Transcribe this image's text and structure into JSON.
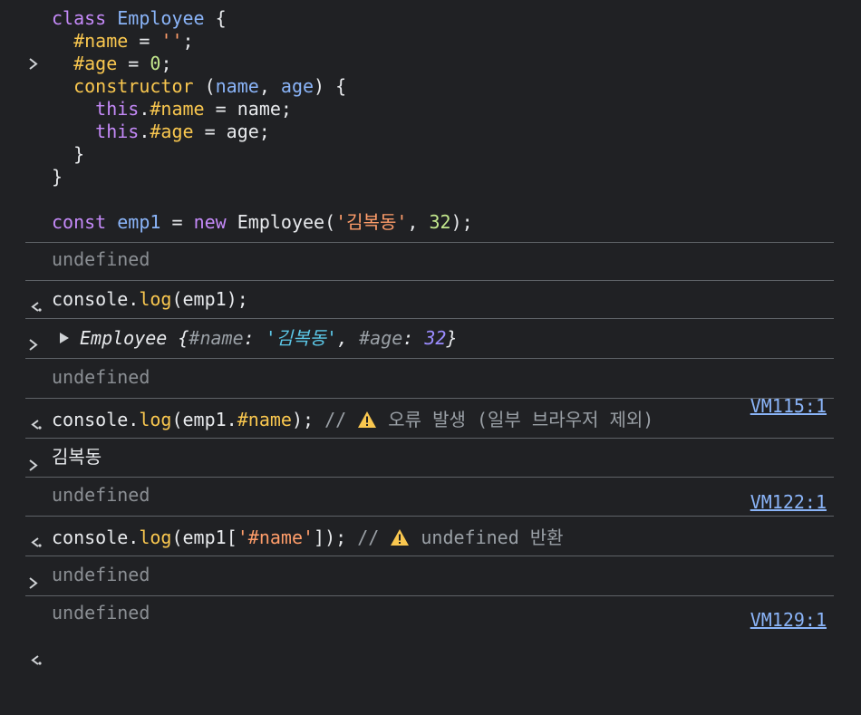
{
  "colors": {
    "background": "#202124",
    "divider": "#5f6368",
    "keyword": "#c58af9",
    "class_name": "#8ab4f8",
    "property": "#f9c74f",
    "string": "#ff9d6a",
    "number": "#c3e88d",
    "link": "#8ab4f8",
    "muted": "#8b8f94"
  },
  "entries": [
    {
      "type": "input",
      "code": [
        "class Employee {",
        "  #name = '';",
        "  #age = 0;",
        "  constructor (name, age) {",
        "    this.#name = name;",
        "    this.#age = age;",
        "  }",
        "}",
        "",
        "const emp1 = new Employee('김복동', 32);"
      ]
    },
    {
      "type": "return",
      "text": "undefined"
    },
    {
      "type": "input",
      "code": [
        "console.log(emp1);"
      ]
    },
    {
      "type": "log",
      "object": {
        "class": "Employee",
        "open": "{",
        "k1": "#name",
        "v1": "'김복동'",
        "sep": ", ",
        "k2": "#age",
        "v2": "32",
        "close": "}"
      },
      "source": "VM115:1"
    },
    {
      "type": "return",
      "text": "undefined"
    },
    {
      "type": "input",
      "code": [
        "console.log(emp1.#name); // ⚠ 오류 발생 (일부 브라우저 제외)"
      ],
      "comment": "// ",
      "comment_text": " 오류 발생 (일부 브라우저 제외)"
    },
    {
      "type": "log",
      "text": "김복동",
      "source": "VM122:1"
    },
    {
      "type": "return",
      "text": "undefined"
    },
    {
      "type": "input",
      "code": [
        "console.log(emp1['#name']); // ⚠ undefined 반환"
      ],
      "comment": "// ",
      "comment_text": " undefined 반환"
    },
    {
      "type": "log",
      "text": "undefined",
      "source": "VM129:1"
    },
    {
      "type": "return",
      "text": "undefined"
    }
  ],
  "tokens": {
    "class": "class",
    "Employee": "Employee",
    "brace_open": " {",
    "hash_name": "#name",
    "hash_age": "#age",
    "eq_empty": " = '';",
    "eq": " = ",
    "empty_str": "''",
    "semi": ";",
    "zero": "0",
    "constructor": "constructor",
    "paren_open": " (",
    "name": "name",
    "comma": ", ",
    "age": "age",
    "paren_close_brace": ") {",
    "this": "this",
    "dot": ".",
    "eq_name": " = name;",
    "eq_age": " = age;",
    "close": "}",
    "const": "const",
    "emp1": "emp1",
    "new": "new",
    "emp_call_open": "Employee(",
    "kbd": "'김복동'",
    "num32": "32",
    "call_close": ");",
    "console": "console",
    "log": "log",
    "log_open": "(",
    "emp1_arg": "emp1",
    "log_close": ");",
    "emp1_dot": "emp1.",
    "log_close2": ");",
    "bracket_open": "[",
    "hash_name_str": "'#name'",
    "bracket_close": "]);",
    "indent2": "  ",
    "indent4": "    "
  }
}
